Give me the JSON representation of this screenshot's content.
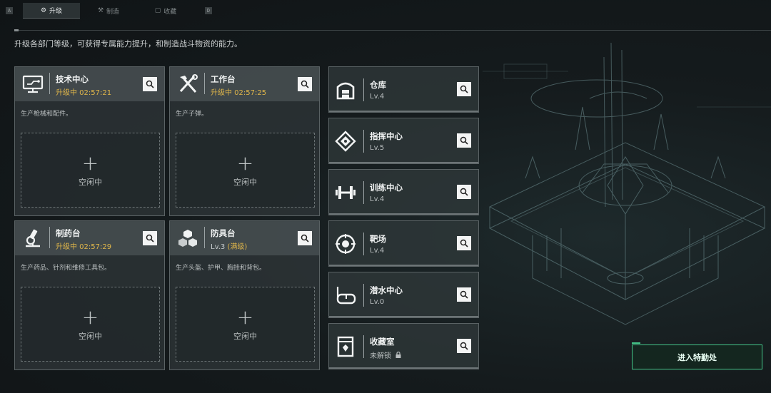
{
  "tabs": {
    "left_key": "A",
    "right_key": "D",
    "items": [
      {
        "label": "升级",
        "icon": "upgrade-icon",
        "active": true
      },
      {
        "label": "制造",
        "icon": "craft-icon",
        "active": false
      },
      {
        "label": "收藏",
        "icon": "collection-icon",
        "active": false
      }
    ]
  },
  "subtitle": "升级各部门等级，可获得专属能力提升，和制造战斗物资的能力。",
  "cards": [
    {
      "name": "技术中心",
      "status": "升级中 02:57:21",
      "desc": "生产枪械和配件。",
      "slot_label": "空闲中",
      "slot_plus": "+",
      "icon": "monitor-icon"
    },
    {
      "name": "工作台",
      "status": "升级中 02:57:25",
      "desc": "生产子弹。",
      "slot_label": "空闲中",
      "slot_plus": "+",
      "icon": "tools-icon"
    },
    {
      "name": "制药台",
      "status": "升级中 02:57:29",
      "desc": "生产药品、针剂和维修工具包。",
      "slot_label": "空闲中",
      "slot_plus": "+",
      "icon": "microscope-icon"
    },
    {
      "name": "防具台",
      "status": "Lv.3",
      "status_extra": "(满级)",
      "desc": "生产头盔、护甲、胸挂和背包。",
      "slot_label": "空闲中",
      "slot_plus": "+",
      "icon": "cubes-icon"
    }
  ],
  "facilities": [
    {
      "name": "仓库",
      "level": "Lv.4",
      "icon": "warehouse-icon"
    },
    {
      "name": "指挥中心",
      "level": "Lv.5",
      "icon": "command-chip-icon"
    },
    {
      "name": "训练中心",
      "level": "Lv.4",
      "icon": "dumbbell-icon"
    },
    {
      "name": "靶场",
      "level": "Lv.4",
      "icon": "target-icon"
    },
    {
      "name": "潜水中心",
      "level": "Lv.0",
      "icon": "dive-mask-icon"
    },
    {
      "name": "收藏室",
      "level": "未解锁",
      "icon": "collection-room-icon",
      "locked": true
    }
  ],
  "enter_button": "进入特勤处",
  "colors": {
    "accent_green": "#44c78a",
    "timer_yellow": "#e0b64a"
  }
}
